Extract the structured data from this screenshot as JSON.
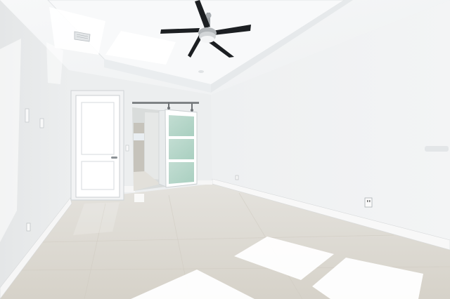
{
  "colors": {
    "wall_left": "#e9ebec",
    "wall_back": "#eef0f1",
    "wall_right": "#f1f2f3",
    "ceiling": "#f5f6f7",
    "floor": "#dcd8d0",
    "baseboard": "#f7f7f7",
    "door": "#ffffff",
    "glass": "#b5d6c9",
    "fan_blade": "#1c1f22",
    "fan_metal": "#9ea3a7",
    "sunlight": "#ffffff"
  },
  "icons": {
    "ceiling_fan": "ceiling-fan-icon",
    "hvac_vent": "air-vent-icon",
    "outlet": "power-outlet-icon",
    "light_switch": "light-switch-icon"
  }
}
